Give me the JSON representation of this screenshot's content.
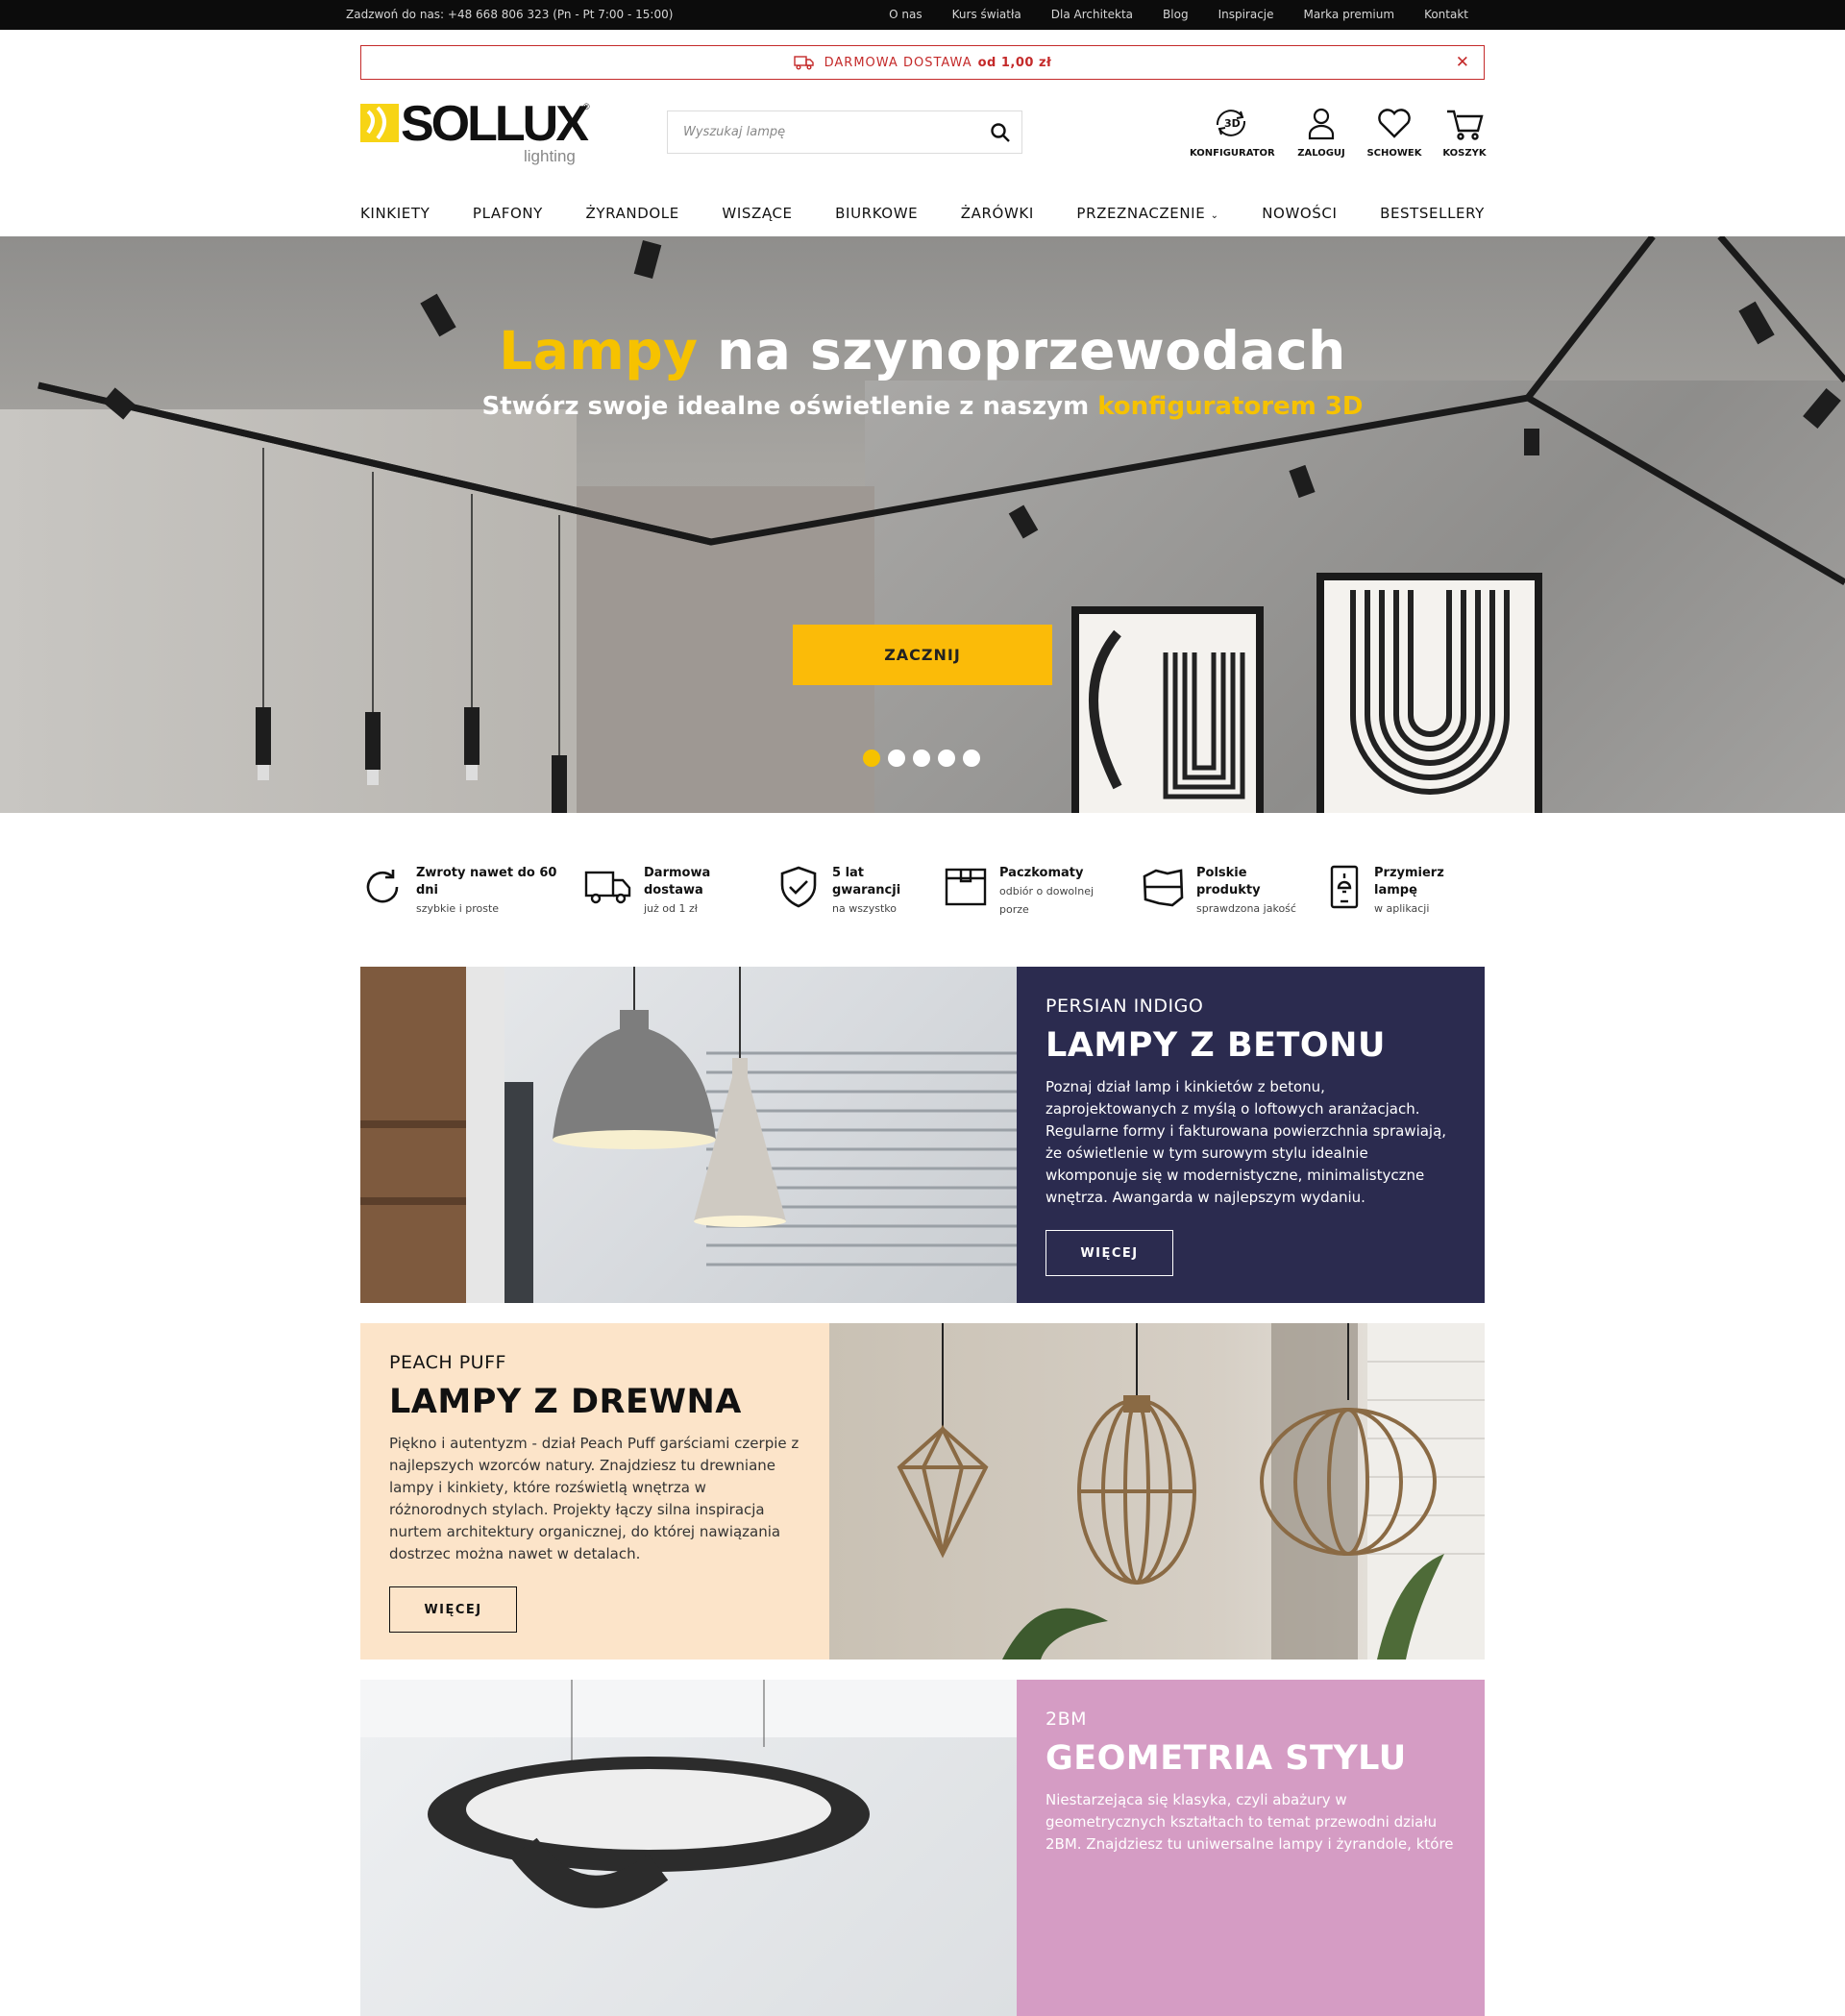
{
  "topbar": {
    "phone": "Zadzwoń do nas: +48 668 806 323 (Pn - Pt 7:00 - 15:00)",
    "links": [
      "O nas",
      "Kurs światła",
      "Dla Architekta",
      "Blog",
      "Inspiracje",
      "Marka premium",
      "Kontakt"
    ]
  },
  "shipping": {
    "label": "DARMOWA DOSTAWA",
    "amount": "od 1,00 zł"
  },
  "logo": {
    "brand": "SOLLUX",
    "tagline": "lighting"
  },
  "search": {
    "placeholder": "Wyszukaj lampę",
    "value": ""
  },
  "header_icons": {
    "configurator": "KONFIGURATOR",
    "login": "ZALOGUJ",
    "wishlist": "SCHOWEK",
    "cart": "KOSZYK"
  },
  "nav": [
    "KINKIETY",
    "PLAFONY",
    "ŻYRANDOLE",
    "WISZĄCE",
    "BIURKOWE",
    "ŻARÓWKI",
    "PRZEZNACZENIE",
    "NOWOŚCI",
    "BESTSELLERY"
  ],
  "hero": {
    "title_highlight": "Lampy",
    "title_rest": " na szynoprzewodach",
    "subtitle": "Stwórz swoje idealne oświetlenie z naszym ",
    "subtitle_highlight": "konfiguratorem 3D",
    "cta": "ZACZNIJ",
    "slides": 5,
    "active_slide": 1
  },
  "features": [
    {
      "icon": "refresh-icon",
      "title": "Zwroty nawet do 60 dni",
      "sub": "szybkie i proste"
    },
    {
      "icon": "truck-icon",
      "title": "Darmowa dostawa",
      "sub": "już od 1 zł"
    },
    {
      "icon": "shield-check-icon",
      "title": "5 lat gwarancji",
      "sub": "na wszystko"
    },
    {
      "icon": "parcel-locker-icon",
      "title": "Paczkomaty",
      "sub": "odbiór o dowolnej porze"
    },
    {
      "icon": "poland-map-icon",
      "title": "Polskie produkty",
      "sub": "sprawdzona jakość"
    },
    {
      "icon": "phone-lamp-icon",
      "title": "Przymierz lampę",
      "sub": "w aplikacji"
    }
  ],
  "promos": [
    {
      "sub": "PERSIAN INDIGO",
      "title": "LAMPY Z BETONU",
      "desc": "Poznaj dział lamp i kinkietów z betonu, zaprojektowanych z myślą o loftowych aranżacjach. Regularne formy i fakturowana powierzchnia sprawiają, że oświetlenie w tym surowym stylu idealnie wkomponuje się w modernistyczne, minimalistyczne wnętrza. Awangarda w najlepszym wydaniu.",
      "button": "WIĘCEJ",
      "bg": "#2b2b4f"
    },
    {
      "sub": "PEACH PUFF",
      "title": "LAMPY Z DREWNA",
      "desc": "Piękno i autentyzm - dział Peach Puff garściami czerpie z najlepszych wzorców natury. Znajdziesz tu drewniane lampy i kinkiety, które rozświetlą wnętrza w różnorodnych stylach. Projekty łączy silna inspiracja nurtem architektury organicznej, do której nawiązania dostrzec można nawet w detalach.",
      "button": "WIĘCEJ",
      "bg": "#fce4c9"
    },
    {
      "sub": "2BM",
      "title": "GEOMETRIA STYLU",
      "desc": "Niestarzejąca się klasyka, czyli abażury w geometrycznych kształtach to temat przewodni działu 2BM. Znajdziesz tu uniwersalne lampy i żyrandole, które",
      "bg": "#d59cc4"
    }
  ]
}
